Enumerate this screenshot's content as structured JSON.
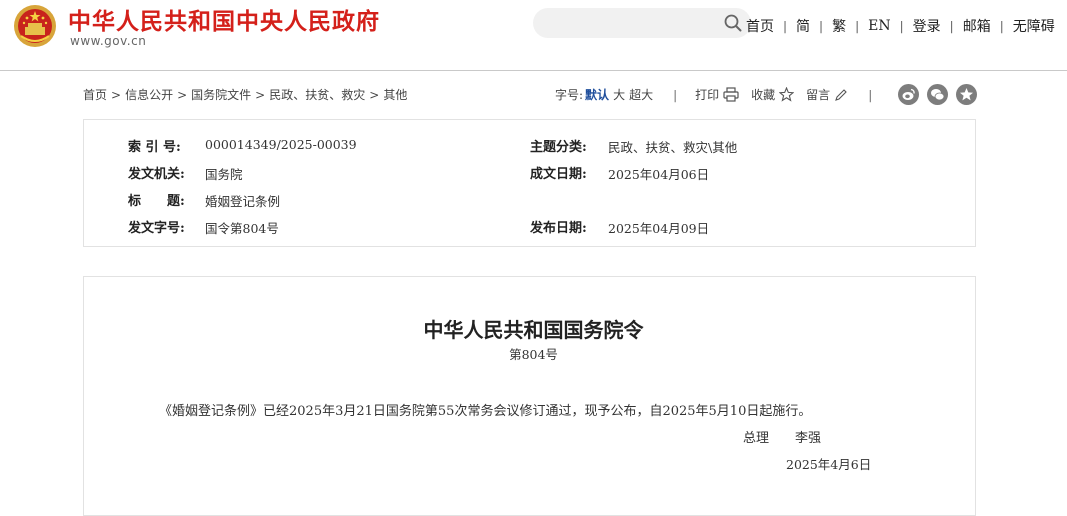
{
  "header": {
    "site_title": "中华人民共和国中央人民政府",
    "site_domain": "www.gov.cn",
    "nav": [
      "首页",
      "简",
      "繁",
      "EN",
      "登录",
      "邮箱",
      "无障碍"
    ]
  },
  "breadcrumb": [
    "首页",
    "信息公开",
    "国务院文件",
    "民政、扶贫、救灾",
    "其他"
  ],
  "toolbar": {
    "font_size_label": "字号:",
    "size_default": "默认",
    "size_large": "大",
    "size_xlarge": "超大",
    "separator": "|",
    "print": "打印",
    "favorite": "收藏",
    "comment": "留言"
  },
  "meta": {
    "index_label": "索 引 号:",
    "index_value": "000014349/2025-00039",
    "topic_label": "主题分类:",
    "topic_value": "民政、扶贫、救灾\\其他",
    "issuer_label": "发文机关:",
    "issuer_value": "国务院",
    "written_label": "成文日期:",
    "written_value": "2025年04月06日",
    "title_label": "标　　题:",
    "title_value": "婚姻登记条例",
    "docno_label": "发文字号:",
    "docno_value": "国令第804号",
    "publish_label": "发布日期:",
    "publish_value": "2025年04月09日"
  },
  "document": {
    "title": "中华人民共和国国务院令",
    "number": "第804号",
    "body": "《婚姻登记条例》已经2025年3月21日国务院第55次常务会议修订通过，现予公布，自2025年5月10日起施行。",
    "signer_title": "总理",
    "signer_name": "李强",
    "date": "2025年4月6日"
  },
  "colors": {
    "brand_red": "#d4201a",
    "active_blue": "#1f4e9c",
    "share_gray": "#7d7d7d"
  },
  "icons": [
    "national-emblem-icon",
    "search-icon",
    "printer-icon",
    "star-icon",
    "pencil-icon",
    "weibo-icon",
    "wechat-icon",
    "favorite-star-icon"
  ]
}
